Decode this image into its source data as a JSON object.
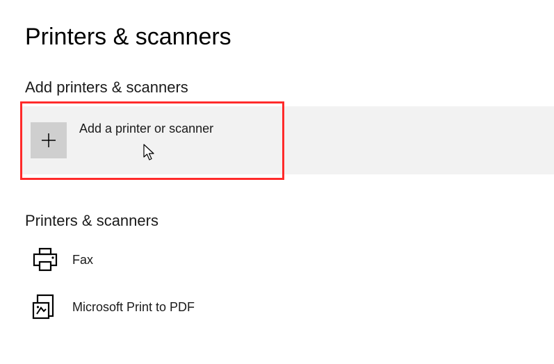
{
  "page": {
    "title": "Printers & scanners"
  },
  "add_section": {
    "heading": "Add printers & scanners",
    "button_label": "Add a printer or scanner"
  },
  "list_section": {
    "heading": "Printers & scanners",
    "items": [
      {
        "label": "Fax",
        "icon": "fax-printer-icon"
      },
      {
        "label": "Microsoft Print to PDF",
        "icon": "pdf-printer-icon"
      }
    ]
  }
}
